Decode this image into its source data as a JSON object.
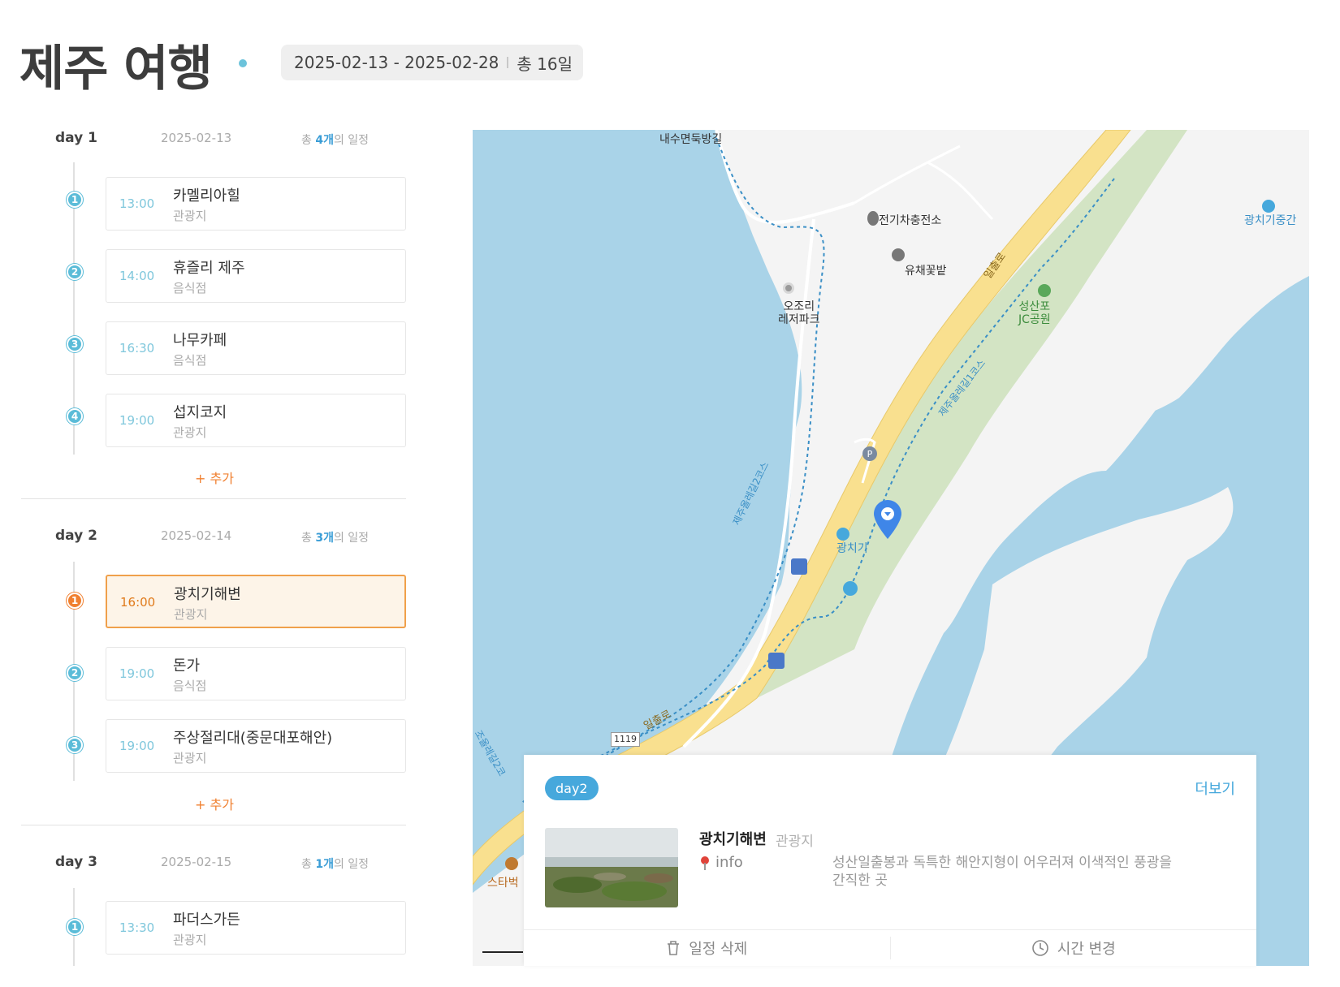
{
  "header": {
    "title": "제주 여행",
    "date_range": "2025-02-13 - 2025-02-28",
    "duration": "총 16일"
  },
  "days": [
    {
      "label": "day 1",
      "date": "2025-02-13",
      "count_prefix": "총 ",
      "count_value": "4개",
      "count_suffix": "의 일정",
      "add_label": "+ 추가",
      "items": [
        {
          "num": "1",
          "time": "13:00",
          "name": "카멜리아힐",
          "category": "관광지"
        },
        {
          "num": "2",
          "time": "14:00",
          "name": "휴즐리 제주",
          "category": "음식점"
        },
        {
          "num": "3",
          "time": "16:30",
          "name": "나무카페",
          "category": "음식점"
        },
        {
          "num": "4",
          "time": "19:00",
          "name": "섭지코지",
          "category": "관광지"
        }
      ]
    },
    {
      "label": "day 2",
      "date": "2025-02-14",
      "count_prefix": "총 ",
      "count_value": "3개",
      "count_suffix": "의 일정",
      "add_label": "+ 추가",
      "items": [
        {
          "num": "1",
          "time": "16:00",
          "name": "광치기해변",
          "category": "관광지"
        },
        {
          "num": "2",
          "time": "19:00",
          "name": "돈가",
          "category": "음식점"
        },
        {
          "num": "3",
          "time": "19:00",
          "name": "주상절리대(중문대포해안)",
          "category": "관광지"
        }
      ]
    },
    {
      "label": "day 3",
      "date": "2025-02-15",
      "count_prefix": "총 ",
      "count_value": "1개",
      "count_suffix": "의 일정",
      "items": [
        {
          "num": "1",
          "time": "13:30",
          "name": "파더스가든",
          "category": "관광지"
        }
      ]
    }
  ],
  "map": {
    "labels": {
      "naesu": "내수면둑방길",
      "charger": "전기차충전소",
      "gwangchigi_jung": "광치기중간",
      "yuchae": "유채꽃밭",
      "ojori": "오조리\n레저파크",
      "seongsanpo": "성산포\nJC공원",
      "gwangchigi": "광치기",
      "route1": "제주올레길1코스",
      "route2": "제주올레길2코스",
      "route2b": "조올레길2코",
      "road_ilchul": "일출로",
      "road_ilchul2": "일출로",
      "road_num": "1119",
      "starbucks": "스타벅"
    },
    "colors": {
      "water": "#a9d3e8",
      "land": "#f4f4f4",
      "park": "#d3e4c4",
      "road": "#f9e08f",
      "pin": "#3f86e8"
    }
  },
  "card": {
    "day_tag": "day2",
    "more_label": "더보기",
    "place_name": "광치기해변",
    "place_category": "관광지",
    "info_label": "info",
    "description": "성산일출봉과 독특한 해안지형이 어우러져 이색적인 풍광을 간직한 곳",
    "delete_label": "일정 삭제",
    "time_change_label": "시간 변경"
  }
}
